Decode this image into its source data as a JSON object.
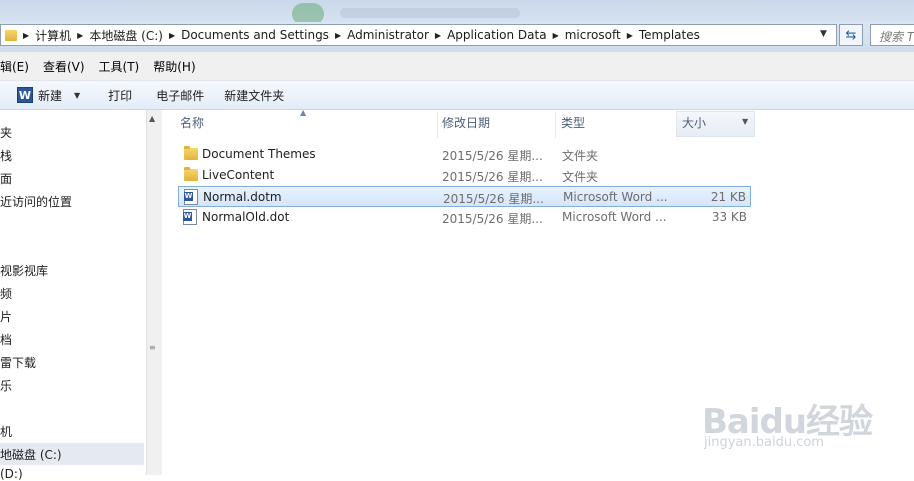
{
  "address": {
    "crumbs": [
      "计算机",
      "本地磁盘 (C:)",
      "Documents and Settings",
      "Administrator",
      "Application Data",
      "microsoft",
      "Templates"
    ],
    "search_placeholder": "搜索 T"
  },
  "menu": [
    "编辑(E)",
    "查看(V)",
    "工具(T)",
    "帮助(H)"
  ],
  "menu_visible": [
    "辑(E)",
    "查看(V)",
    "工具(T)",
    "帮助(H)"
  ],
  "toolbar": {
    "new_label": "新建",
    "print_label": "打印",
    "email_label": "电子邮件",
    "new_folder_label": "新建文件夹"
  },
  "nav": {
    "items": [
      "夹",
      "栈",
      "面",
      "近访问的位置",
      "视影视库",
      "频",
      "片",
      "档",
      "雷下载",
      "乐",
      "机",
      "地磁盘 (C:)",
      "(D:)"
    ]
  },
  "columns": {
    "name": "名称",
    "date": "修改日期",
    "type": "类型",
    "size": "大小"
  },
  "files": [
    {
      "name": "Document Themes",
      "date": "2015/5/26 星期...",
      "type": "文件夹",
      "size": "",
      "icon": "folder-icon"
    },
    {
      "name": "LiveContent",
      "date": "2015/5/26 星期...",
      "type": "文件夹",
      "size": "",
      "icon": "folder-icon"
    },
    {
      "name": "Normal.dotm",
      "date": "2015/5/26 星期...",
      "type": "Microsoft Word ...",
      "size": "21 KB",
      "icon": "word-document-icon",
      "selected": true
    },
    {
      "name": "NormalOld.dot",
      "date": "2015/5/26 星期...",
      "type": "Microsoft Word ...",
      "size": "33 KB",
      "icon": "word-document-icon"
    }
  ],
  "watermark": {
    "brand": "Baidu经验",
    "url": "jingyan.baidu.com"
  },
  "colors": {
    "selection_border": "#84acdd",
    "toolbar_gradient_top": "#f5f9fe",
    "header_text": "#4c607a"
  }
}
